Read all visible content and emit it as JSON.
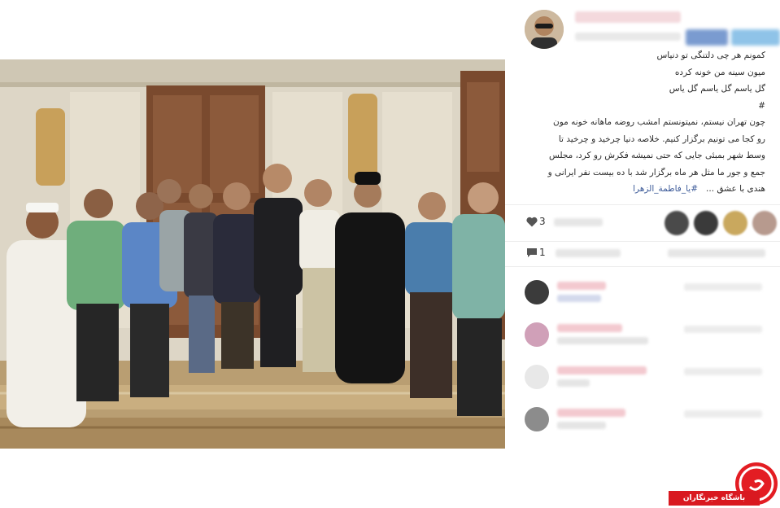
{
  "post": {
    "username": "ⓑⓐⓛⓜⓐⓨ",
    "caption_lines": [
      "کمونم هر چی دلتنگی تو دنیاس",
      "میون سینه من خونه کرده",
      "گل یاسم گل یاسم گل یاس",
      "#",
      "چون تهران نیستم، نمیتونستم امشب روضه ماهانه خونه مون",
      "رو کجا می تونیم برگزار کنیم. خلاصه دنیا چرخید و چرخید تا",
      "وسط شهر بمبئی جایی که حتی نمیشه فکرش رو کرد، مجلس",
      "جمع و جور ما مثل هر ماه برگزار شد با ده بیست نفر ایرانی و"
    ],
    "caption_last_prefix": "هندی با عشق ...",
    "caption_hashtag": "#یا_فاطمة_الزهرا"
  },
  "stats": {
    "likes_count": "3",
    "comments_count": "1"
  },
  "icons": {
    "like": "heart-icon",
    "comment": "speech-bubble-icon"
  },
  "watermark": {
    "text": "باشگاه خبرنگاران",
    "color": "#d91920"
  }
}
